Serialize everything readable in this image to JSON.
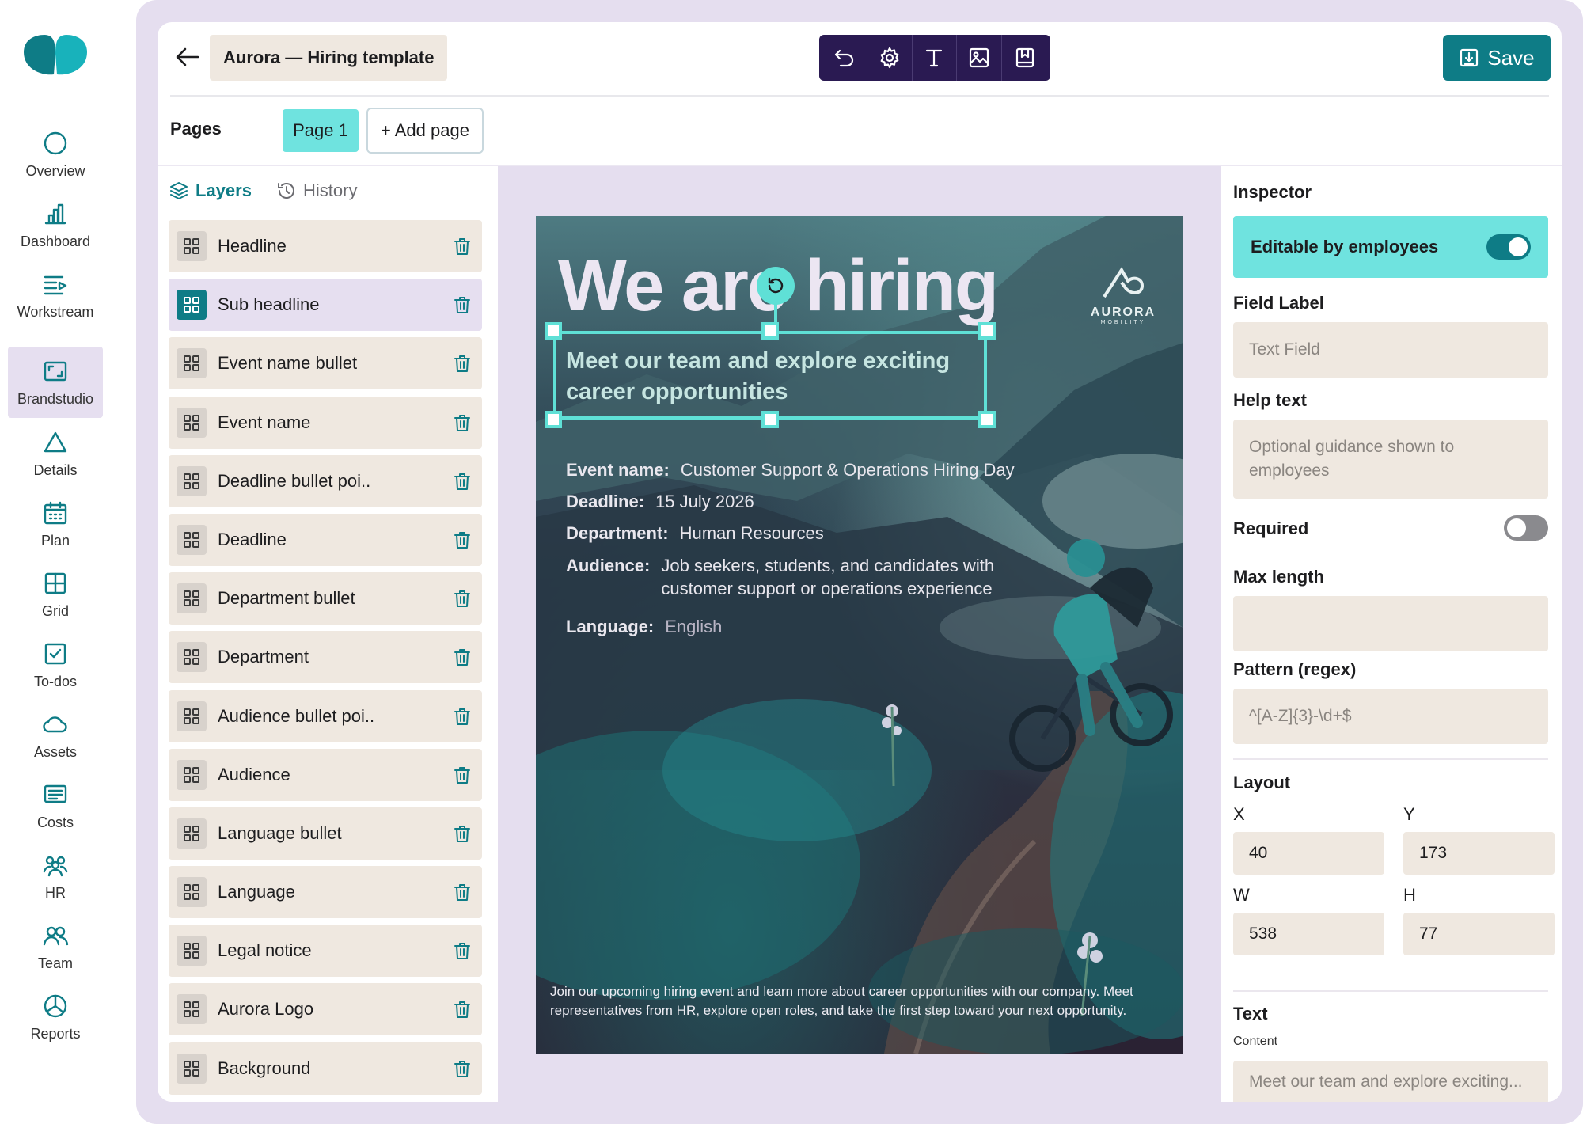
{
  "nav": {
    "items": [
      {
        "label": "Overview",
        "icon": "circle-icon"
      },
      {
        "label": "Dashboard",
        "icon": "bar-chart-icon"
      },
      {
        "label": "Workstream",
        "icon": "workstream-icon"
      },
      {
        "label": "Brandstudio",
        "icon": "frame-icon",
        "active": true
      },
      {
        "label": "Details",
        "icon": "triangle-icon"
      },
      {
        "label": "Plan",
        "icon": "calendar-icon"
      },
      {
        "label": "Grid",
        "icon": "grid-icon"
      },
      {
        "label": "To-dos",
        "icon": "checkbox-icon"
      },
      {
        "label": "Assets",
        "icon": "cloud-icon"
      },
      {
        "label": "Costs",
        "icon": "receipt-icon"
      },
      {
        "label": "HR",
        "icon": "people-icon"
      },
      {
        "label": "Team",
        "icon": "team-icon"
      },
      {
        "label": "Reports",
        "icon": "pie-icon"
      }
    ]
  },
  "header": {
    "title": "Aurora — Hiring template",
    "save_label": "Save"
  },
  "pages": {
    "label": "Pages",
    "tabs": [
      "Page 1"
    ],
    "add_label": "+ Add page"
  },
  "layers_panel": {
    "tab_layers": "Layers",
    "tab_history": "History",
    "items": [
      "Headline",
      "Sub headline",
      "Event name bullet",
      "Event name",
      "Deadline bullet poi..",
      "Deadline",
      "Department bullet",
      "Department",
      "Audience bullet poi..",
      "Audience",
      "Language bullet",
      "Language",
      "Legal notice",
      "Aurora Logo",
      "Background"
    ],
    "selected_index": 1
  },
  "poster": {
    "headline": "We are hiring",
    "brand_name": "AURORA",
    "brand_sub": "MOBILITY",
    "sub_headline": "Meet our team and explore exciting career opportunities",
    "event_label": "Event name:",
    "event_value": "Customer Support & Operations Hiring Day",
    "deadline_label": "Deadline:",
    "deadline_value": "15 July 2026",
    "department_label": "Department:",
    "department_value": "Human Resources",
    "audience_label": "Audience:",
    "audience_value": "Job seekers, students, and candidates with customer support or operations experience",
    "language_label": "Language:",
    "language_value": "English",
    "legal": "Join our upcoming hiring event and learn more about career opportunities with our company. Meet representatives from HR, explore open roles, and take the first step toward your next opportunity."
  },
  "inspector": {
    "title": "Inspector",
    "editable_label": "Editable by employees",
    "editable_on": true,
    "field_label_title": "Field Label",
    "field_label_placeholder": "Text Field",
    "help_text_title": "Help text",
    "help_text_placeholder": "Optional guidance shown to employees",
    "required_title": "Required",
    "required_on": false,
    "max_length_title": "Max length",
    "max_length_value": "",
    "pattern_title": "Pattern (regex)",
    "pattern_placeholder": "^[A-Z]{3}-\\d+$",
    "layout_title": "Layout",
    "x_label": "X",
    "x_value": "40",
    "y_label": "Y",
    "y_value": "173",
    "w_label": "W",
    "w_value": "538",
    "h_label": "H",
    "h_value": "77",
    "text_title": "Text",
    "content_label": "Content",
    "content_value": "Meet our team and explore exciting..."
  },
  "colors": {
    "accent": "#0e7c86",
    "highlight": "#6fe3df",
    "toolbar": "#2a1a52",
    "frame": "#e5deef",
    "field_bg": "#efe8e0"
  }
}
